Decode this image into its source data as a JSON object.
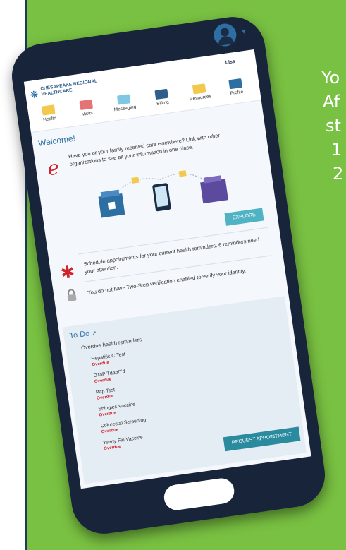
{
  "side_lines": [
    "Yo",
    "Af",
    "st",
    "1",
    "2"
  ],
  "header": {
    "org_name": "CHESAPEAKE REGIONAL HEALTHCARE",
    "profile_name": "Lisa"
  },
  "nav": [
    {
      "label": "Health",
      "icon": "heart-icon",
      "color": "#f2c94c"
    },
    {
      "label": "Visits",
      "icon": "calendar-icon",
      "color": "#e57373"
    },
    {
      "label": "Messaging",
      "icon": "envelope-icon",
      "color": "#7ec8e3"
    },
    {
      "label": "Billing",
      "icon": "card-icon",
      "color": "#2d5f8a"
    },
    {
      "label": "Resources",
      "icon": "folder-icon",
      "color": "#f2c94c"
    },
    {
      "label": "Profile",
      "icon": "id-card-icon",
      "color": "#2d6fa3"
    }
  ],
  "welcome": "Welcome!",
  "link_card": {
    "text": "Have you or your family received care elsewhere? Link with other organizations to see all your information in one place.",
    "button": "EXPLORE"
  },
  "reminders_text": "Schedule appointments for your current health reminders. 6 reminders need your attention.",
  "twostep_text": "You do not have Two-Step verification enabled to verify your identity.",
  "todo": {
    "title": "To Do",
    "subtitle": "Overdue health reminders",
    "items": [
      {
        "name": "Hepatitis C Test",
        "status": "Overdue"
      },
      {
        "name": "DTaP/Tdap/Td",
        "status": "Overdue"
      },
      {
        "name": "Pap Test",
        "status": "Overdue"
      },
      {
        "name": "Shingles Vaccine",
        "status": "Overdue"
      },
      {
        "name": "Colorectal Screening",
        "status": "Overdue"
      },
      {
        "name": "Yearly Flu Vaccine",
        "status": "Overdue"
      }
    ],
    "button": "REQUEST APPOINTMENT"
  },
  "colors": {
    "green_bg": "#79c142",
    "phone": "#17243a",
    "accent_blue": "#2d6fa3",
    "overdue_red": "#d0232c",
    "button_teal": "#2a8a9e"
  }
}
